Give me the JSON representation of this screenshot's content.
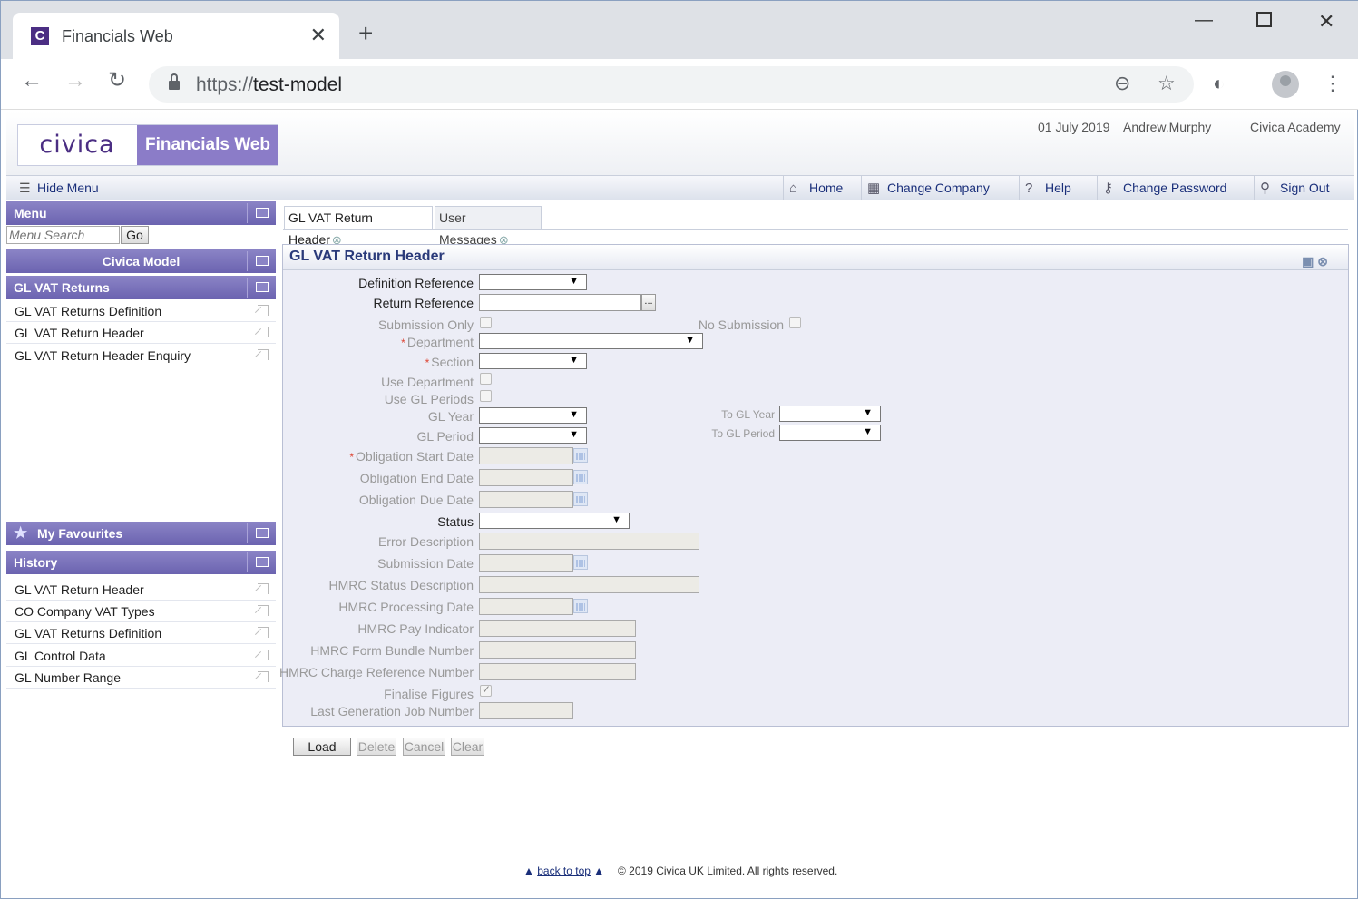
{
  "browser": {
    "tab_title": "Financials Web",
    "favicon_letter": "C",
    "url_scheme": "https://",
    "url_host": "test-model"
  },
  "header": {
    "logo_text": "civica",
    "product_name": "Financials Web",
    "date": "01 July 2019",
    "user": "Andrew.Murphy",
    "org": "Civica Academy"
  },
  "navbar": {
    "hide_menu": "Hide Menu",
    "home": "Home",
    "change_company": "Change Company",
    "help": "Help",
    "change_password": "Change Password",
    "sign_out": "Sign Out"
  },
  "sidebar": {
    "menu_title": "Menu",
    "search_placeholder": "Menu Search",
    "go": "Go",
    "company": "Civica Model",
    "section": "GL VAT Returns",
    "items": [
      "GL VAT Returns Definition",
      "GL VAT Return Header",
      "GL VAT Return Header Enquiry"
    ],
    "favourites_title": "My Favourites",
    "history_title": "History",
    "history": [
      "GL VAT Return Header",
      "CO Company VAT Types",
      "GL VAT Returns Definition",
      "GL Control Data",
      "GL Number Range"
    ]
  },
  "tabs": [
    "GL VAT Return Header",
    "User Messages"
  ],
  "form": {
    "title": "GL VAT Return Header",
    "labels": {
      "definition_reference": "Definition Reference",
      "return_reference": "Return Reference",
      "submission_only": "Submission Only",
      "no_submission": "No Submission",
      "department": "Department",
      "section": "Section",
      "use_department": "Use Department",
      "use_gl_periods": "Use GL Periods",
      "gl_year": "GL Year",
      "to_gl_year": "To GL Year",
      "gl_period": "GL Period",
      "to_gl_period": "To GL Period",
      "obligation_start_date": "Obligation Start Date",
      "obligation_end_date": "Obligation End Date",
      "obligation_due_date": "Obligation Due Date",
      "status": "Status",
      "error_description": "Error Description",
      "submission_date": "Submission Date",
      "hmrc_status_description": "HMRC Status Description",
      "hmrc_processing_date": "HMRC Processing Date",
      "hmrc_pay_indicator": "HMRC Pay Indicator",
      "hmrc_form_bundle_number": "HMRC Form Bundle Number",
      "hmrc_charge_reference_number": "HMRC Charge Reference Number",
      "finalise_figures": "Finalise Figures",
      "last_generation_job_number": "Last Generation Job Number"
    },
    "required_mark": "*",
    "ellipsis": "..."
  },
  "actions": {
    "load": "Load",
    "delete": "Delete",
    "cancel": "Cancel",
    "clear": "Clear"
  },
  "footer": {
    "back_to_top": "back to top",
    "copyright": "© 2019 Civica UK Limited. All rights reserved."
  }
}
